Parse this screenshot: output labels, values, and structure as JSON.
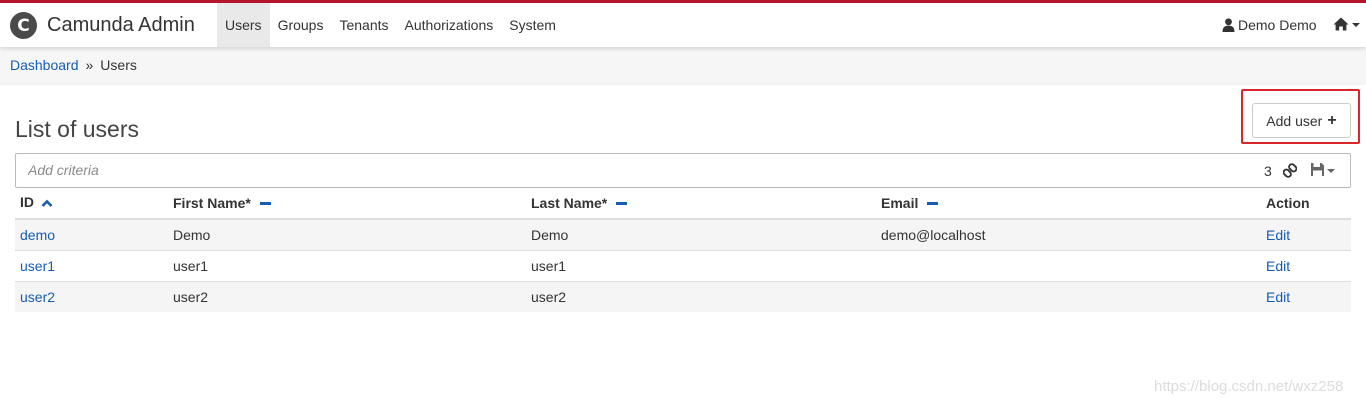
{
  "app": {
    "logo_letter": "C",
    "title": "Camunda Admin"
  },
  "nav": {
    "items": [
      {
        "label": "Users",
        "active": true
      },
      {
        "label": "Groups",
        "active": false
      },
      {
        "label": "Tenants",
        "active": false
      },
      {
        "label": "Authorizations",
        "active": false
      },
      {
        "label": "System",
        "active": false
      }
    ]
  },
  "user_menu": {
    "name": "Demo Demo",
    "icon": "user-icon"
  },
  "home_menu": {
    "icon": "home-icon"
  },
  "breadcrumb": {
    "link": "Dashboard",
    "separator": "»",
    "current": "Users"
  },
  "page": {
    "title": "List of users",
    "add_button_label": "Add user",
    "add_button_icon": "+"
  },
  "search": {
    "placeholder": "Add criteria",
    "value": "",
    "result_count": "3"
  },
  "table": {
    "headers": {
      "id": "ID",
      "first_name": "First Name*",
      "last_name": "Last Name*",
      "email": "Email",
      "action": "Action"
    },
    "sort": {
      "id": "ascending",
      "first_name": "none",
      "last_name": "none",
      "email": "none"
    },
    "rows": [
      {
        "id": "demo",
        "first_name": "Demo",
        "last_name": "Demo",
        "email": "demo@localhost",
        "action": "Edit"
      },
      {
        "id": "user1",
        "first_name": "user1",
        "last_name": "user1",
        "email": "",
        "action": "Edit"
      },
      {
        "id": "user2",
        "first_name": "user2",
        "last_name": "user2",
        "email": "",
        "action": "Edit"
      }
    ]
  },
  "watermark": "https://blog.csdn.net/wxz258",
  "colors": {
    "brand_red": "#b5152b",
    "link_blue": "#155cb5",
    "highlight_red": "#d9262b"
  }
}
